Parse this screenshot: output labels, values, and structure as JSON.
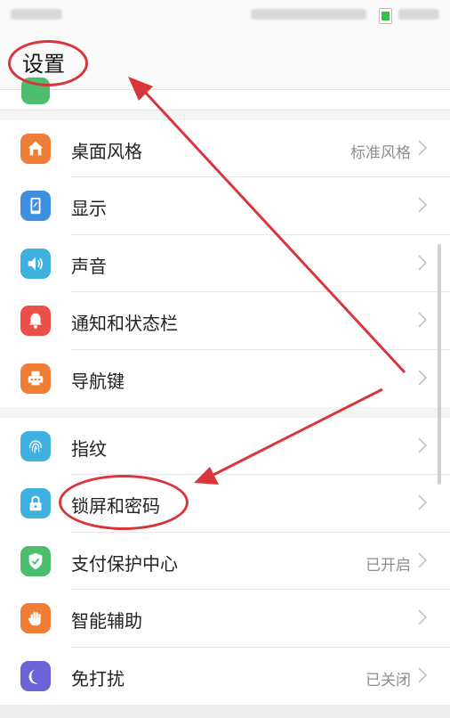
{
  "header": {
    "title": "设置"
  },
  "settings": {
    "group1": [
      {
        "label": "桌面风格",
        "value": "标准风格",
        "icon": "home-icon",
        "color": "#ef7d35"
      },
      {
        "label": "显示",
        "value": "",
        "icon": "phone-display-icon",
        "color": "#3f8fe0"
      },
      {
        "label": "声音",
        "value": "",
        "icon": "speaker-icon",
        "color": "#3fb0e0"
      },
      {
        "label": "通知和状态栏",
        "value": "",
        "icon": "bell-icon",
        "color": "#ec4f47"
      },
      {
        "label": "导航键",
        "value": "",
        "icon": "navigation-keys-icon",
        "color": "#ef7d35"
      }
    ],
    "group2": [
      {
        "label": "指纹",
        "value": "",
        "icon": "fingerprint-icon",
        "color": "#3fb0e0"
      },
      {
        "label": "锁屏和密码",
        "value": "",
        "icon": "lock-icon",
        "color": "#3fb0e0"
      },
      {
        "label": "支付保护中心",
        "value": "已开启",
        "icon": "shield-check-icon",
        "color": "#4dbd6e"
      },
      {
        "label": "智能辅助",
        "value": "",
        "icon": "hand-icon",
        "color": "#ef7d35"
      },
      {
        "label": "免打扰",
        "value": "已关闭",
        "icon": "moon-icon",
        "color": "#6b63d6"
      }
    ]
  },
  "colors": {
    "annotation": "#d8363a",
    "chevron": "#c2c2c2",
    "value_text": "#8e8e8e"
  }
}
